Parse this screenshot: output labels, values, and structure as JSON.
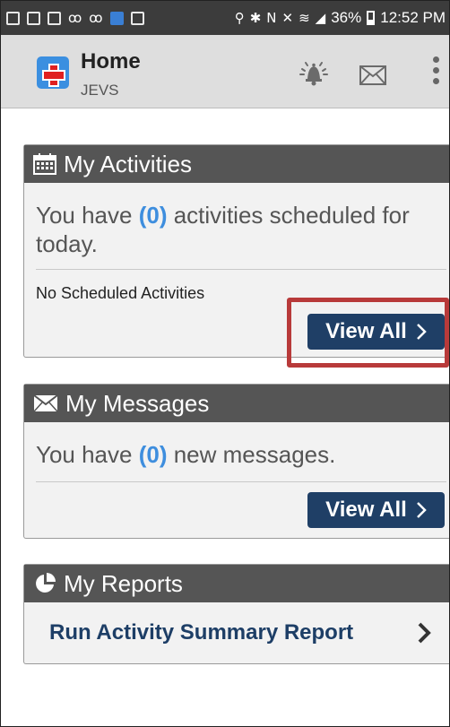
{
  "status_bar": {
    "battery": "36%",
    "time": "12:52 PM",
    "icons": [
      "notification-icon",
      "notification-icon",
      "image-icon",
      "voicemail-icon",
      "voicemail-icon",
      "maps-icon",
      "notification-icon",
      "location-icon",
      "bluetooth-icon",
      "nfc-icon",
      "mute-icon",
      "wifi-icon",
      "signal-icon",
      "battery-icon"
    ]
  },
  "app_bar": {
    "title": "Home",
    "subtitle": "JEVS",
    "icons": [
      "app-logo-icon",
      "bell-icon",
      "mail-icon",
      "overflow-menu-icon"
    ]
  },
  "activities": {
    "header": "My Activities",
    "icon": "calendar-icon",
    "summary_prefix": "You have ",
    "count": "(0)",
    "summary_suffix": " activities scheduled for today.",
    "empty_text": "No Scheduled Activities",
    "view_all_label": "View All"
  },
  "messages": {
    "header": "My Messages",
    "icon": "envelope-icon",
    "summary_prefix": "You have ",
    "count": "(0)",
    "summary_suffix": " new messages.",
    "view_all_label": "View All"
  },
  "reports": {
    "header": "My Reports",
    "icon": "pie-chart-icon",
    "link_label": "Run Activity Summary Report"
  },
  "colors": {
    "header_bg": "#555555",
    "button_bg": "#1f3f66",
    "count_blue": "#3e8ede",
    "highlight": "#b83a3a"
  }
}
